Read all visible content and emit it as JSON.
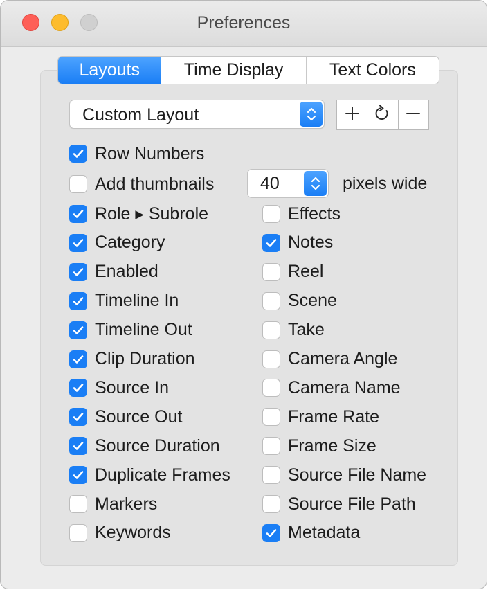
{
  "window": {
    "title": "Preferences",
    "traffic_lights": {
      "close_color": "#fe5f57",
      "minimize_color": "#fdbc2e",
      "zoom_color": "#d0d0d0"
    }
  },
  "tabs": [
    {
      "label": "Layouts",
      "selected": true
    },
    {
      "label": "Time Display",
      "selected": false
    },
    {
      "label": "Text Colors",
      "selected": false
    }
  ],
  "layout_popup": {
    "value": "Custom Layout",
    "icon": "up-down-chevron-icon"
  },
  "layout_actions": [
    {
      "name": "add-layout-button",
      "icon": "plus-icon"
    },
    {
      "name": "refresh-layout-button",
      "icon": "refresh-icon"
    },
    {
      "name": "remove-layout-button",
      "icon": "minus-icon"
    }
  ],
  "thumbnail": {
    "label": "Add thumbnails",
    "checked": false,
    "value": "40",
    "suffix": "pixels wide"
  },
  "checkboxes_full_width": [
    {
      "label": "Row Numbers",
      "checked": true
    }
  ],
  "left_column": [
    {
      "label": "Role ▸ Subrole",
      "checked": true
    },
    {
      "label": "Category",
      "checked": true
    },
    {
      "label": "Enabled",
      "checked": true
    },
    {
      "label": "Timeline In",
      "checked": true
    },
    {
      "label": "Timeline Out",
      "checked": true
    },
    {
      "label": "Clip Duration",
      "checked": true
    },
    {
      "label": "Source In",
      "checked": true
    },
    {
      "label": "Source Out",
      "checked": true
    },
    {
      "label": "Source Duration",
      "checked": true
    },
    {
      "label": "Duplicate Frames",
      "checked": true
    },
    {
      "label": "Markers",
      "checked": false
    },
    {
      "label": "Keywords",
      "checked": false
    }
  ],
  "right_column": [
    {
      "label": "Effects",
      "checked": false
    },
    {
      "label": "Notes",
      "checked": true
    },
    {
      "label": "Reel",
      "checked": false
    },
    {
      "label": "Scene",
      "checked": false
    },
    {
      "label": "Take",
      "checked": false
    },
    {
      "label": "Camera Angle",
      "checked": false
    },
    {
      "label": "Camera Name",
      "checked": false
    },
    {
      "label": "Frame Rate",
      "checked": false
    },
    {
      "label": "Frame Size",
      "checked": false
    },
    {
      "label": "Source File Name",
      "checked": false
    },
    {
      "label": "Source File Path",
      "checked": false
    },
    {
      "label": "Metadata",
      "checked": true
    }
  ],
  "colors": {
    "accent": "#1a7ef5",
    "window_bg": "#ececec",
    "panel_bg": "#e3e3e3"
  }
}
